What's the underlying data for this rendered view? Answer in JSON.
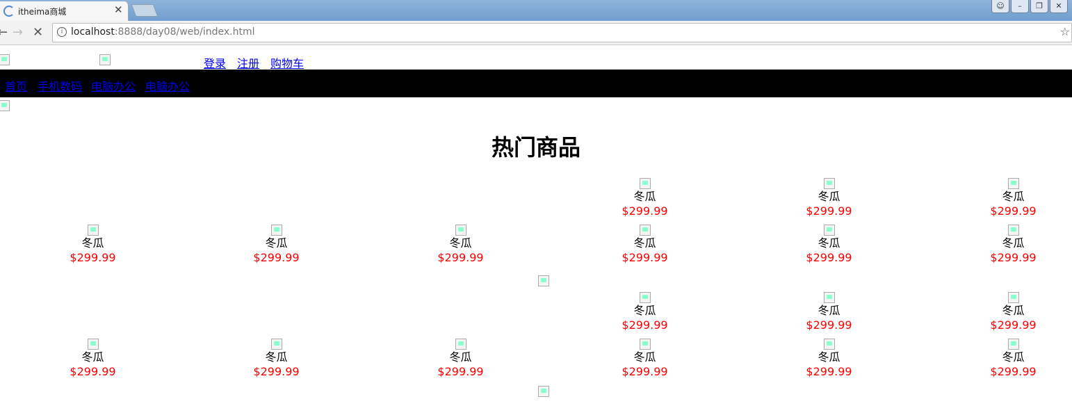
{
  "browser": {
    "tab_title": "itheima商城",
    "close_glyph": "✕",
    "url_host": "localhost",
    "url_rest": ":8888/day08/web/index.html"
  },
  "header": {
    "links": [
      "登录",
      "注册",
      "购物车"
    ]
  },
  "nav": {
    "items": [
      "首页",
      "手机数码",
      "电脑办公",
      "电脑办公"
    ]
  },
  "section": {
    "title": "热门商品"
  },
  "product": {
    "name": "冬瓜",
    "price": "$299.99"
  }
}
